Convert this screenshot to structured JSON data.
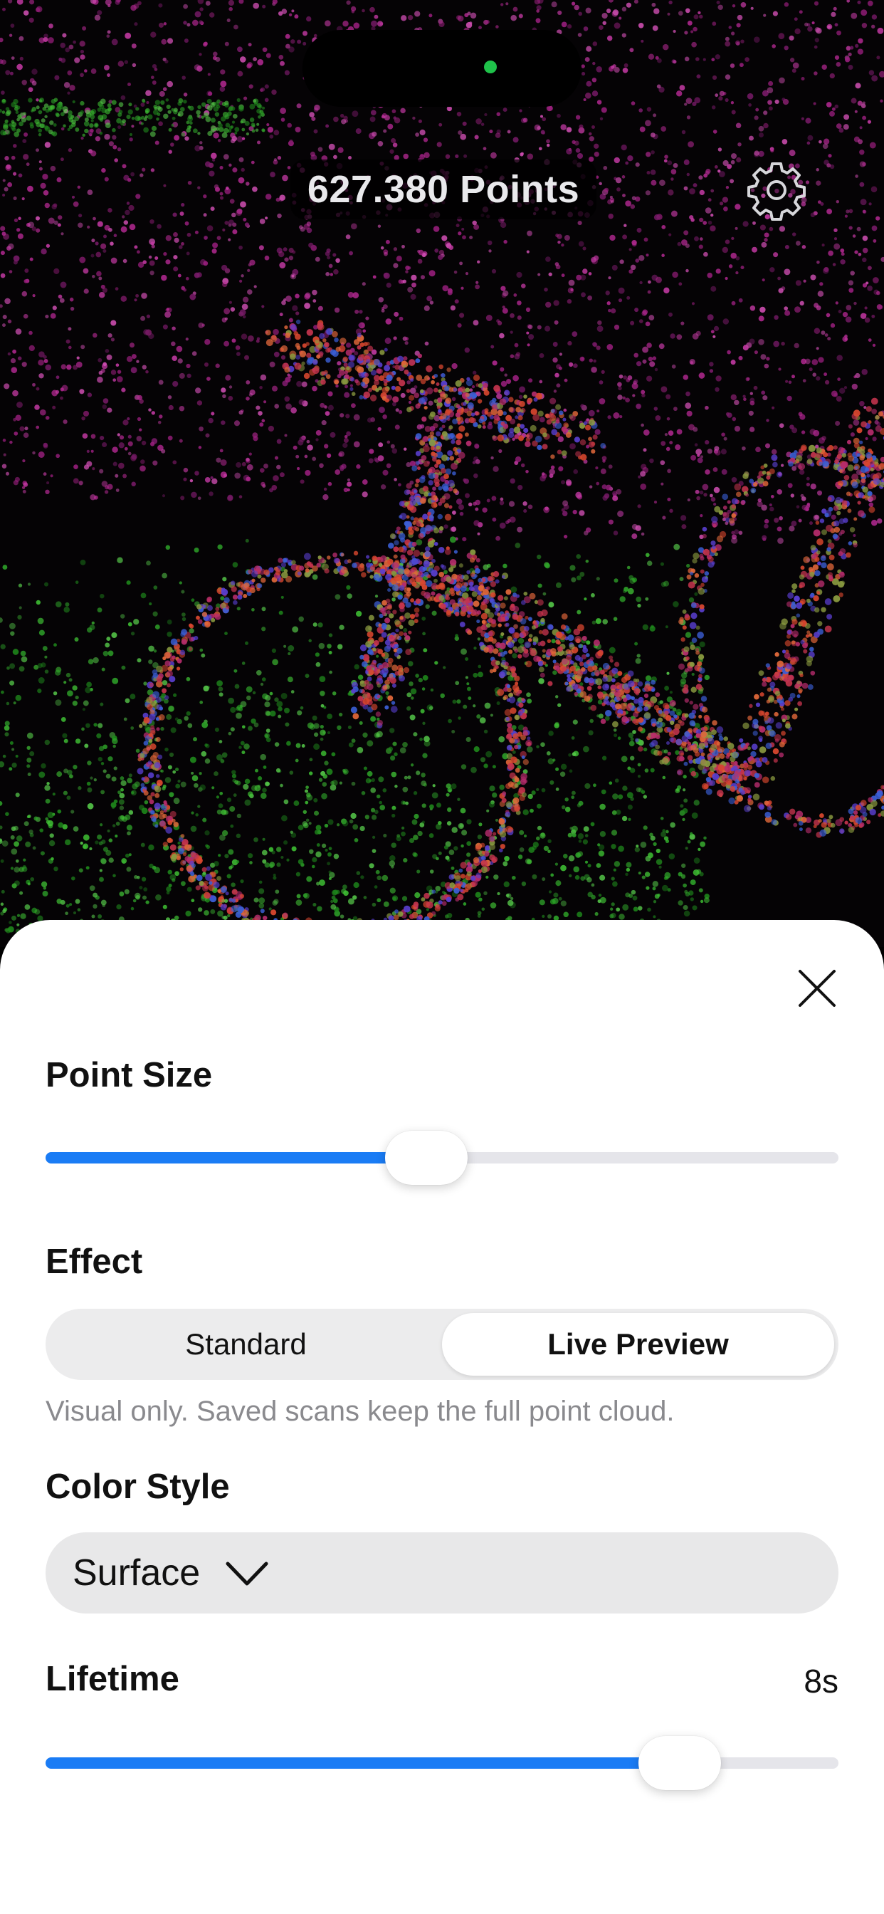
{
  "status_bar": {
    "indicator_color": "#1fc24a"
  },
  "overlay": {
    "points_count": "627.380 Points",
    "settings_icon": "gear-icon"
  },
  "sheet": {
    "close_icon": "close-icon",
    "point_size": {
      "label": "Point Size",
      "value_fraction": 0.48
    },
    "effect": {
      "label": "Effect",
      "options": [
        "Standard",
        "Live Preview"
      ],
      "selected": "Live Preview",
      "hint": "Visual only. Saved scans keep the full point cloud."
    },
    "color_style": {
      "label": "Color Style",
      "selected": "Surface",
      "chevron_icon": "chevron-down-icon"
    },
    "lifetime": {
      "label": "Lifetime",
      "value": "8s",
      "value_fraction": 0.8
    }
  },
  "colors": {
    "accent": "#1a7cf5",
    "track": "#e5e5ea",
    "sheet_background": "#ffffff"
  }
}
